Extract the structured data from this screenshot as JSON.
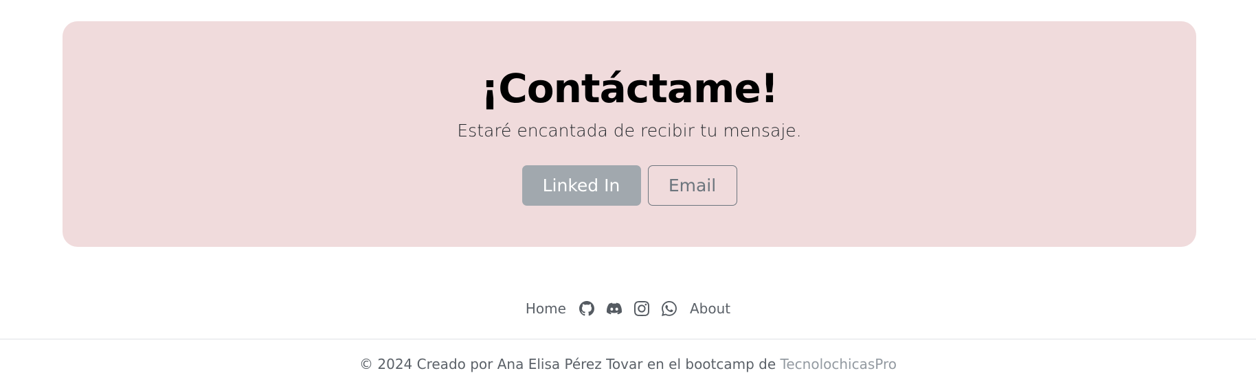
{
  "contact": {
    "title": "¡Contáctame!",
    "subtitle": "Estaré encantada de recibir tu mensaje.",
    "linkedin_label": "Linked In",
    "email_label": "Email",
    "colors": {
      "card_bg": "#f0dbdc",
      "linkedin_bg": "#a1a8ae",
      "email_border": "#6c757d"
    }
  },
  "footer": {
    "nav": {
      "home_label": "Home",
      "about_label": "About",
      "icons": [
        "github-icon",
        "discord-icon",
        "instagram-icon",
        "whatsapp-icon"
      ]
    },
    "copyright_text": "© 2024 Creado por Ana Elisa Pérez Tovar en el bootcamp de ",
    "brand_link": "TecnolochicasPro"
  }
}
